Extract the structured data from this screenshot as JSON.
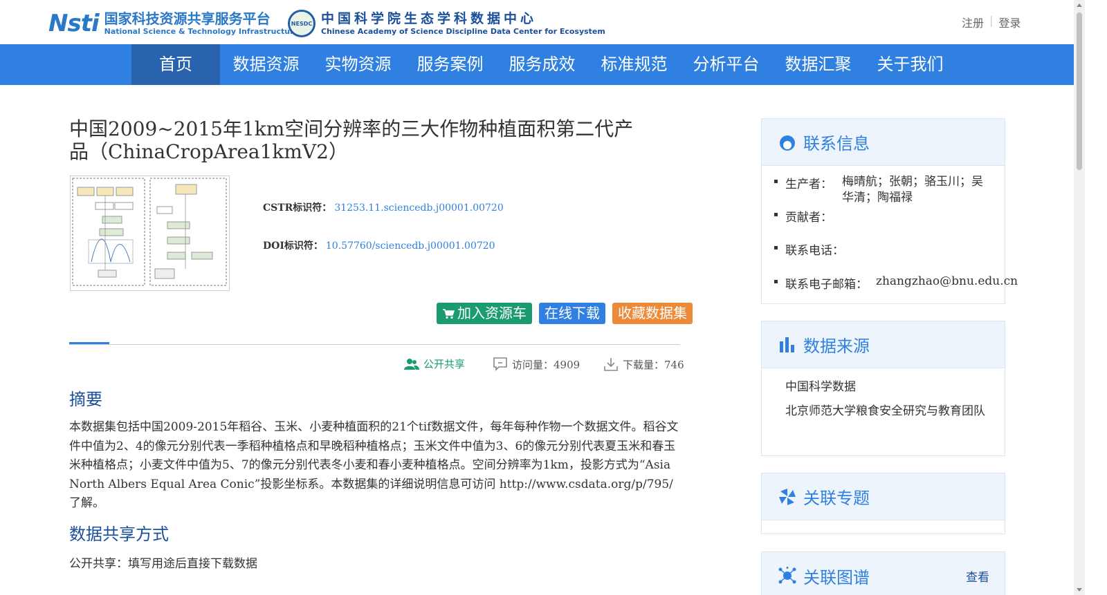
{
  "header": {
    "logo1_mark": "Nsti",
    "logo1_cn": "国家科技资源共享服务平台",
    "logo1_en": "National Science & Technology Infrastructure",
    "logo2_seal": "NESDC",
    "logo2_cn": "中国科学院生态学科数据中心",
    "logo2_en": "Chinese Academy of Science Discipline Data Center for Ecosystem",
    "register": "注册",
    "login": "登录"
  },
  "nav": {
    "items": [
      "首页",
      "数据资源",
      "实物资源",
      "服务案例",
      "服务成效",
      "标准规范",
      "分析平台",
      "数据汇聚",
      "关于我们"
    ],
    "active_index": 0
  },
  "dataset": {
    "title": "中国2009~2015年1km空间分辨率的三大作物种植面积第二代产品（ChinaCropArea1kmV2）",
    "cstr_label": "CSTR标识符：",
    "cstr_value": "31253.11.sciencedb.j00001.00720",
    "doi_label": "DOI标识符：",
    "doi_value": "10.57760/sciencedb.j00001.00720"
  },
  "actions": {
    "cart": "加入资源车",
    "download": "在线下载",
    "favorite": "收藏数据集"
  },
  "stats": {
    "share_mode": "公开共享",
    "visits": "访问量：4909",
    "downloads": "下载量：746"
  },
  "abstract": {
    "heading": "摘要",
    "text": "本数据集包括中国2009-2015年稻谷、玉米、小麦种植面积的21个tif数据文件，每年每种作物一个数据文件。稻谷文件中值为2、4的像元分别代表一季稻种植格点和早晚稻种植格点；玉米文件中值为3、6的像元分别代表夏玉米和春玉米种植格点；小麦文件中值为5、7的像元分别代表冬小麦和春小麦种植格点。空间分辨率为1km，投影方式为“Asia North Albers Equal Area Conic”投影坐标系。本数据集的详细说明信息可访问 http://www.csdata.org/p/795/ 了解。"
  },
  "sharing": {
    "heading": "数据共享方式",
    "text": "公开共享：填写用途后直接下载数据"
  },
  "sidebar": {
    "contact": {
      "title": "联系信息",
      "producer_label": "生产者：",
      "producer_value_line1": "梅晴航；张朝；骆玉川；吴",
      "producer_value_line2": "华清；陶福禄",
      "contributor_label": "贡献者：",
      "phone_label": "联系电话：",
      "email_label": "联系电子邮箱：",
      "email_value": "zhangzhao@bnu.edu.cn"
    },
    "source": {
      "title": "数据来源",
      "items": [
        "中国科学数据",
        "北京师范大学粮食安全研究与教育团队"
      ]
    },
    "topic": {
      "title": "关联专题"
    },
    "graph": {
      "title": "关联图谱",
      "more": "查看"
    }
  },
  "colors": {
    "nav_bg": "#2f80e0",
    "nav_active": "#2a63ad",
    "btn_cart": "#1a9c6e",
    "btn_download": "#2f80e0",
    "btn_favorite": "#ed8a3a",
    "heading": "#1a4f9c"
  }
}
